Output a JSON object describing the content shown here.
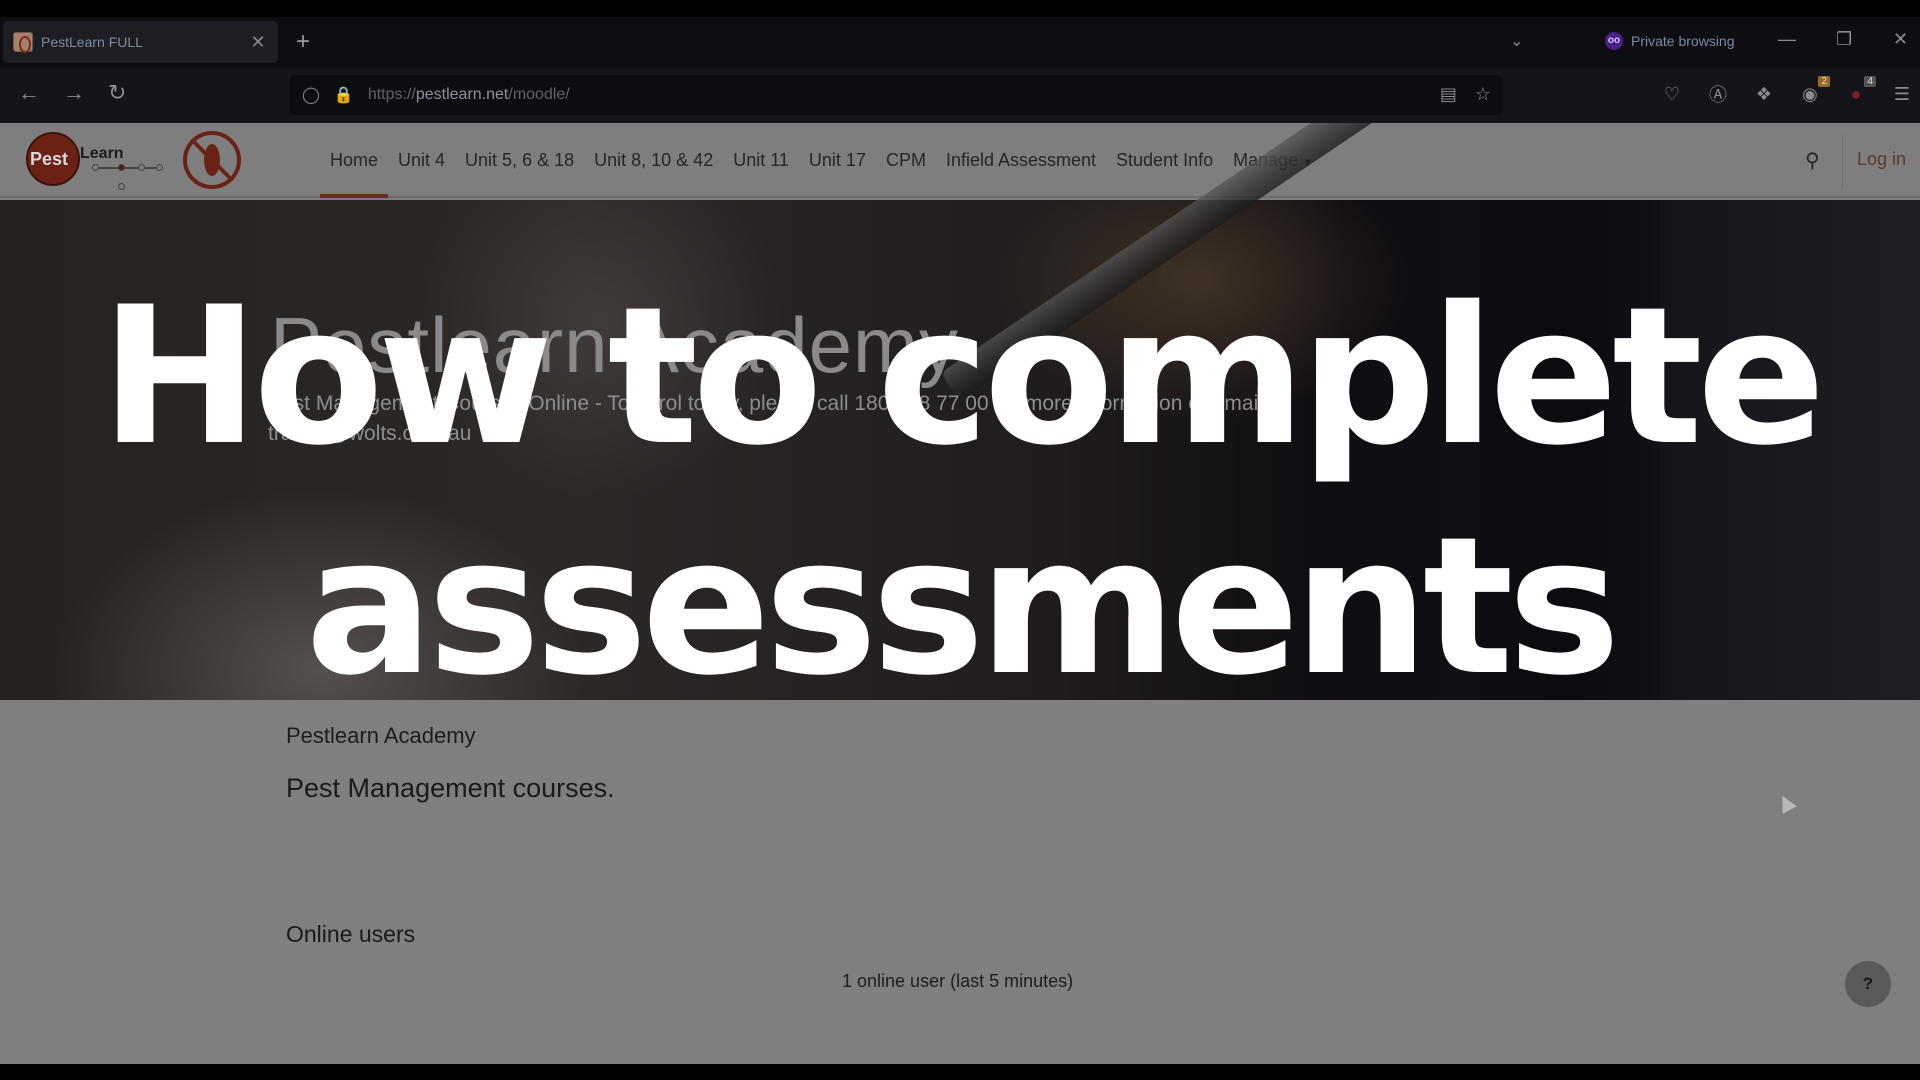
{
  "browser": {
    "tab": {
      "title": "PestLearn FULL",
      "close_icon": "close-icon"
    },
    "new_tab_label": "+",
    "private_label": "Private browsing",
    "url": {
      "scheme": "https://",
      "domain": "pestlearn.net",
      "path": "/moodle/"
    },
    "extensions": [
      {
        "name": "pocket-icon",
        "badge": ""
      },
      {
        "name": "account-icon",
        "badge": ""
      },
      {
        "name": "extensions-icon",
        "badge": ""
      },
      {
        "name": "tampermonkey-icon",
        "badge": "2"
      },
      {
        "name": "ublock-icon",
        "badge": "4"
      }
    ]
  },
  "site": {
    "logo_pest": "Pest",
    "logo_learn": "Learn",
    "nav": [
      {
        "label": "Home",
        "active": true
      },
      {
        "label": "Unit 4"
      },
      {
        "label": "Unit 5, 6 & 18"
      },
      {
        "label": "Unit 8, 10 & 42"
      },
      {
        "label": "Unit 11"
      },
      {
        "label": "Unit 17"
      },
      {
        "label": "CPM"
      },
      {
        "label": "Infield Assessment"
      },
      {
        "label": "Student Info"
      },
      {
        "label": "Manage"
      }
    ],
    "login_label": "Log in"
  },
  "hero": {
    "title": "Pestlearn Academy",
    "subtitle": "Pest Management Courses Online - To enrol today, please call 1800 88 77 00 for more information or email",
    "email": "trainer@wolts.com.au"
  },
  "content": {
    "site_name": "Pestlearn Academy",
    "summary": "Pest Management courses.",
    "online_users_heading": "Online users",
    "online_users_value": "1 online user (last 5 minutes)"
  },
  "help_label": "?",
  "overlay": {
    "line1": "How to complete",
    "line2": "assessments"
  },
  "colors": {
    "accent": "#a33b22",
    "dim_overlay": "#7f7f7f",
    "overlay_text": "#ffffff"
  }
}
